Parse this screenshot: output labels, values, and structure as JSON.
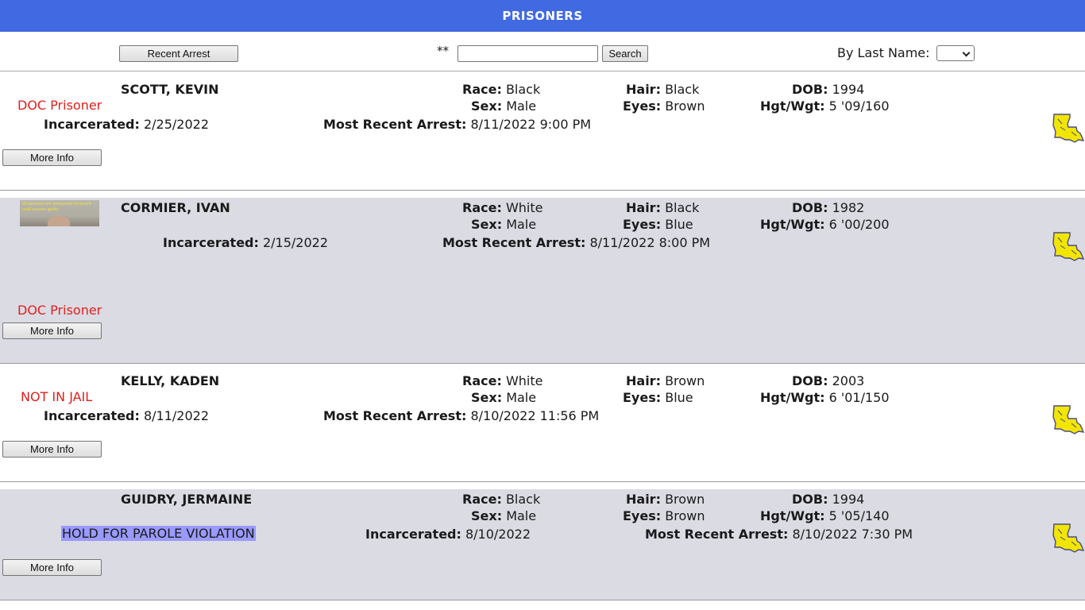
{
  "header": {
    "title": "PRISONERS"
  },
  "toolbar": {
    "recent_arrest_label": "Recent Arrest",
    "search_prefix": "**",
    "search_value": "",
    "search_button_label": "Search",
    "by_last_name_label": "By Last Name:",
    "last_name_selected": ""
  },
  "field_labels": {
    "race": "Race:",
    "sex": "Sex:",
    "hair": "Hair:",
    "eyes": "Eyes:",
    "dob": "DOB:",
    "hgt_wgt": "Hgt/Wgt:",
    "incarcerated": "Incarcerated:",
    "most_recent_arrest": "Most Recent Arrest:",
    "more_info": "More Info"
  },
  "prisoners": [
    {
      "name": "SCOTT, KEVIN",
      "status": "DOC Prisoner",
      "race": "Black",
      "sex": "Male",
      "hair": "Black",
      "eyes": "Brown",
      "dob": "1994",
      "hgt_wgt": "5 '09/160",
      "incarcerated": "2/25/2022",
      "most_recent_arrest": "8/11/2022 9:00 PM"
    },
    {
      "name": "CORMIER, IVAN",
      "status": "DOC Prisoner",
      "photo_caption": "all persons are presumed innocent until proven guilty",
      "race": "White",
      "sex": "Male",
      "hair": "Black",
      "eyes": "Blue",
      "dob": "1982",
      "hgt_wgt": "6 '00/200",
      "incarcerated": "2/15/2022",
      "most_recent_arrest": "8/11/2022 8:00 PM"
    },
    {
      "name": "KELLY, KADEN",
      "status": "NOT IN JAIL",
      "race": "White",
      "sex": "Male",
      "hair": "Brown",
      "eyes": "Blue",
      "dob": "2003",
      "hgt_wgt": "6 '01/150",
      "incarcerated": "8/11/2022",
      "most_recent_arrest": "8/10/2022 11:56 PM"
    },
    {
      "name": "GUIDRY, JERMAINE",
      "status": "HOLD FOR PAROLE VIOLATION",
      "race": "Black",
      "sex": "Male",
      "hair": "Brown",
      "eyes": "Brown",
      "dob": "1994",
      "hgt_wgt": "5 '05/140",
      "incarcerated": "8/10/2022",
      "most_recent_arrest": "8/10/2022 7:30 PM"
    }
  ],
  "icons": {
    "state_icon": "louisiana-state-icon",
    "state_icon_color": "#f2e600"
  }
}
